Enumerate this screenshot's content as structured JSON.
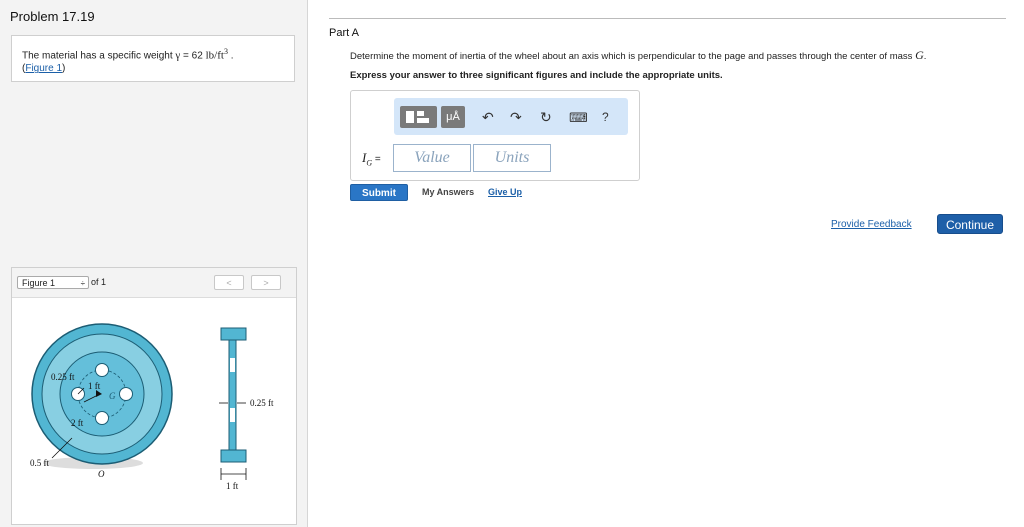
{
  "problem": {
    "title": "Problem 17.19",
    "text_pre": "The material has a specific weight ",
    "gamma": "γ",
    "eq": " = 62 ",
    "units": "lb/ft",
    "units_exp": "3",
    "period": " .",
    "figure_link": "Figure 1",
    "paren_open": "(",
    "paren_close": ")"
  },
  "figure_nav": {
    "selected": "Figure 1",
    "select_arrows": "÷",
    "of_text": "of 1",
    "prev": "<",
    "next": ">"
  },
  "figure": {
    "labels": {
      "r025": "0.25 ft",
      "r1": "1 ft",
      "g": "G",
      "r2": "2 ft",
      "r05": "0.5 ft",
      "o": "O",
      "thick025": "0.25 ft",
      "width1": "1 ft"
    }
  },
  "part": {
    "title": "Part A",
    "question_pre": "Determine the moment of inertia of the wheel about an axis which is perpendicular to the page and passes through the center of mass ",
    "question_var": "G",
    "question_post": ".",
    "instruction": "Express your answer to three significant figures and include the appropriate units."
  },
  "answer": {
    "var": "I",
    "var_sub": "G",
    "eq": " =",
    "value_placeholder": "Value",
    "units_placeholder": "Units",
    "toolbar": {
      "micro_label": "μÅ",
      "undo": "↶",
      "redo": "↷",
      "reset": "↻",
      "keyboard": "⌨",
      "help": "?"
    }
  },
  "actions": {
    "submit": "Submit",
    "my_answers": "My Answers",
    "give_up": "Give Up",
    "provide_feedback": "Provide Feedback",
    "continue": "Continue"
  }
}
